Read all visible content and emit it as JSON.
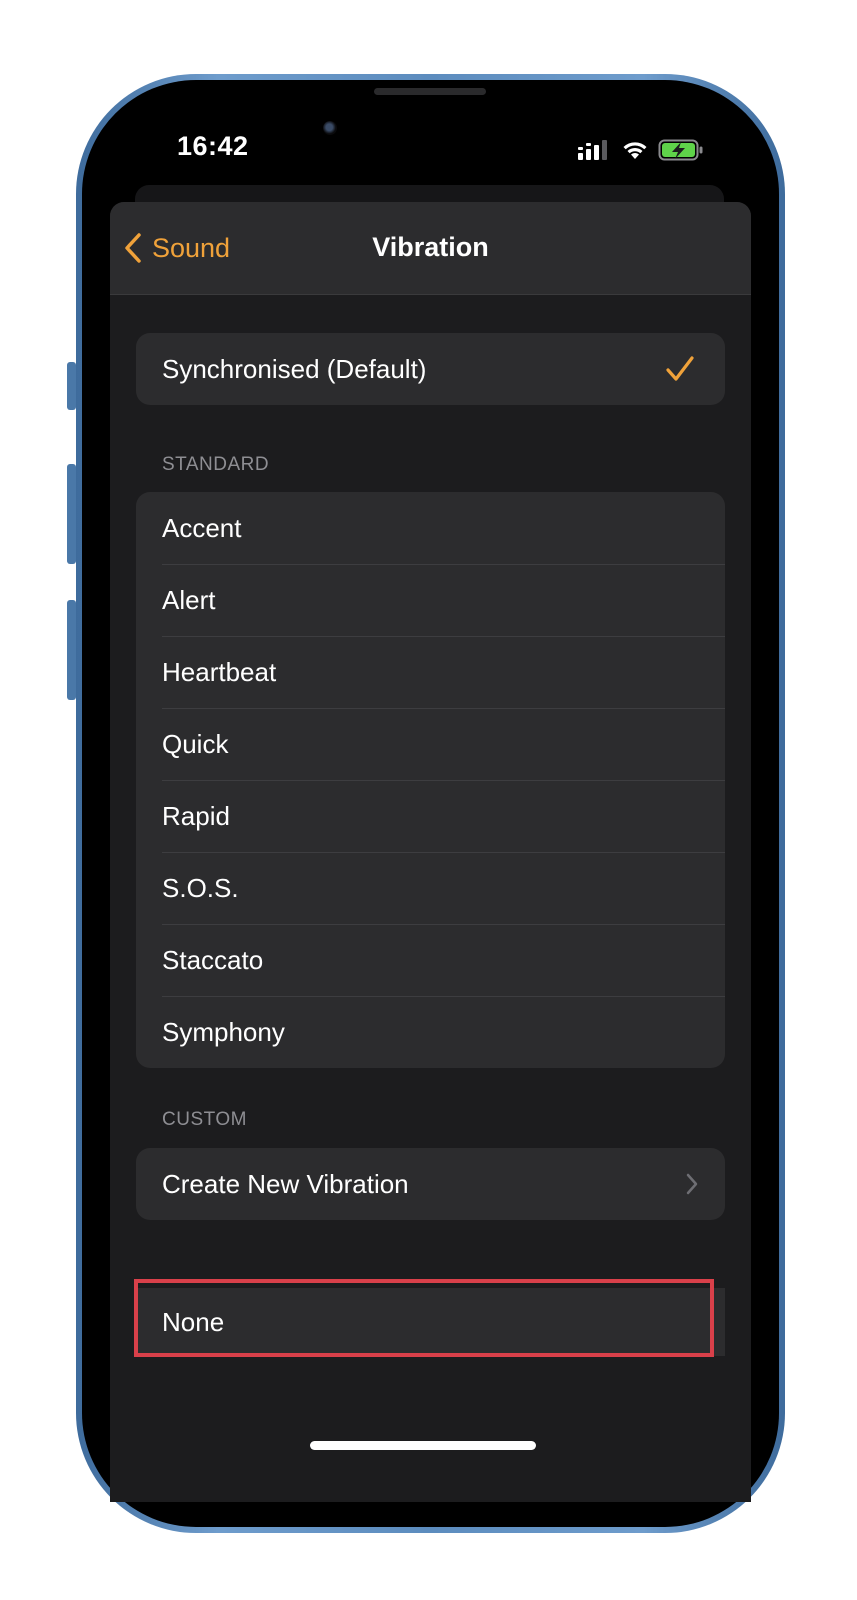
{
  "status_bar": {
    "time": "16:42",
    "signal_icon": "cellular-signal-icon",
    "wifi_icon": "wifi-icon",
    "battery_icon": "battery-charging-icon",
    "battery_color": "#5fd34a"
  },
  "nav": {
    "back_label": "Sound",
    "title": "Vibration",
    "accent_color": "#f0a23a"
  },
  "default_option": {
    "label": "Synchronised (Default)",
    "selected": true
  },
  "standard_section": {
    "header": "STANDARD",
    "items": [
      {
        "label": "Accent"
      },
      {
        "label": "Alert"
      },
      {
        "label": "Heartbeat"
      },
      {
        "label": "Quick"
      },
      {
        "label": "Rapid"
      },
      {
        "label": "S.O.S."
      },
      {
        "label": "Staccato"
      },
      {
        "label": "Symphony"
      }
    ]
  },
  "custom_section": {
    "header": "CUSTOM",
    "create_label": "Create New Vibration"
  },
  "none_option": {
    "label": "None",
    "highlight_color": "#d9404a"
  }
}
